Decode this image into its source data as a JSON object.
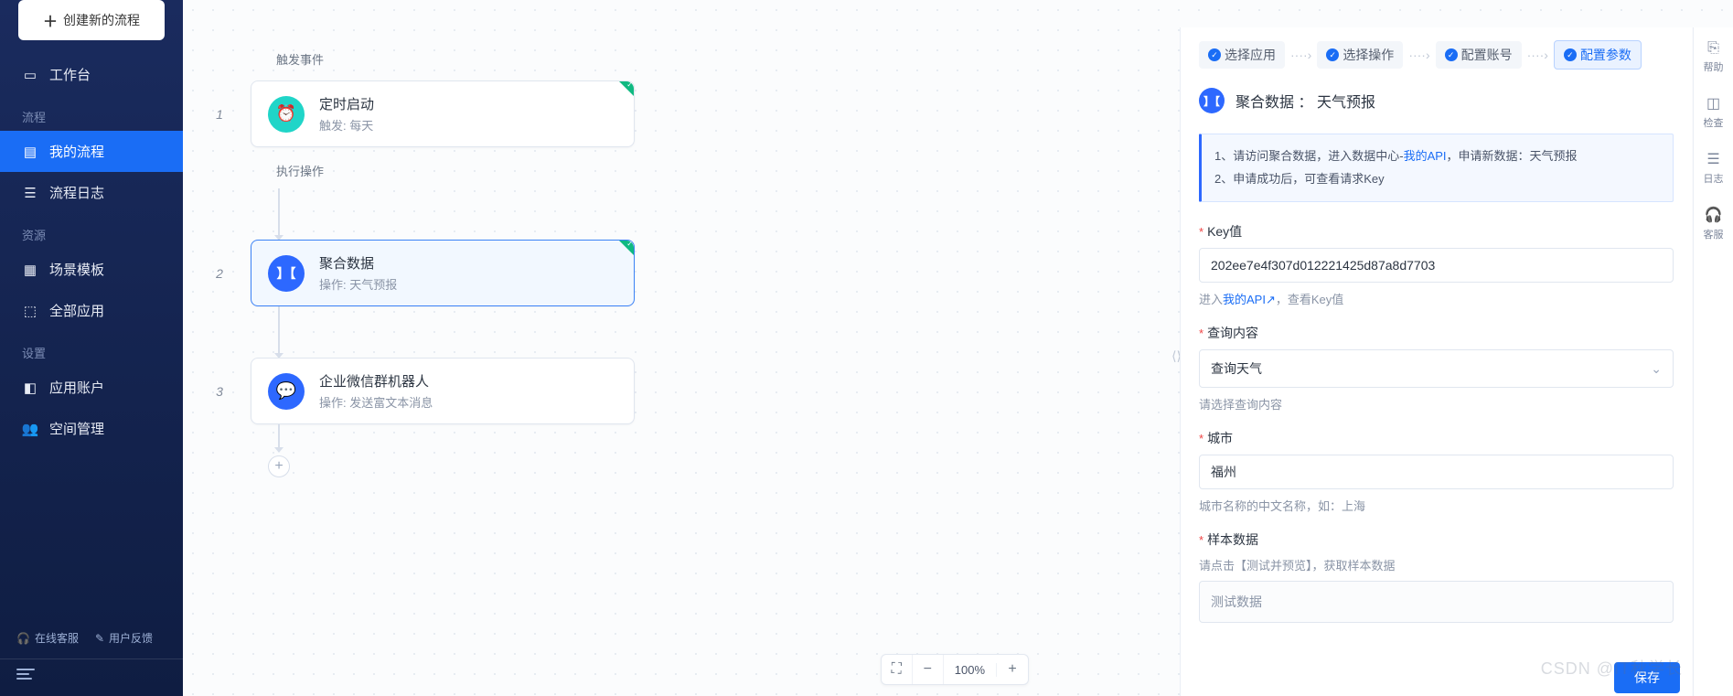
{
  "sidebar": {
    "create_label": "创建新的流程",
    "workspace": "工作台",
    "sections": {
      "flow": "流程",
      "resource": "资源",
      "settings": "设置"
    },
    "items": {
      "my_flows": "我的流程",
      "flow_logs": "流程日志",
      "scene_templates": "场景模板",
      "all_apps": "全部应用",
      "app_accounts": "应用账户",
      "space_mgmt": "空间管理"
    },
    "footer": {
      "online_support": "在线客服",
      "feedback": "用户反馈"
    }
  },
  "flow": {
    "trigger_label": "触发事件",
    "exec_label": "执行操作",
    "steps": [
      {
        "num": "1",
        "title": "定时启动",
        "sub_prefix": "触发:",
        "sub_value": "每天",
        "icon": "timer"
      },
      {
        "num": "2",
        "title": "聚合数据",
        "sub_prefix": "操作:",
        "sub_value": "天气预报",
        "icon": "juhe",
        "selected": true
      },
      {
        "num": "3",
        "title": "企业微信群机器人",
        "sub_prefix": "操作:",
        "sub_value": "发送富文本消息",
        "icon": "wework"
      }
    ]
  },
  "zoom": {
    "value": "100%"
  },
  "panel": {
    "steps": [
      "选择应用",
      "选择操作",
      "配置账号",
      "配置参数"
    ],
    "active_step_index": 3,
    "head": {
      "app": "聚合数据",
      "action": "天气预报",
      "sep": "："
    },
    "info": {
      "line1_a": "1、请访问聚合数据，进入数据中心-",
      "line1_link": "我的API",
      "line1_b": "，申请新数据：天气预报",
      "line2": "2、申请成功后，可查看请求Key"
    },
    "fields": {
      "key": {
        "label": "Key值",
        "value": "202ee7e4f307d012221425d87a8d7703",
        "hint_a": "进入",
        "hint_link": "我的API",
        "hint_b": "，查看Key值",
        "ext_icon": "↗"
      },
      "query": {
        "label": "查询内容",
        "value": "查询天气",
        "hint": "请选择查询内容"
      },
      "city": {
        "label": "城市",
        "value": "福州",
        "hint": "城市名称的中文名称，如：上海"
      },
      "sample": {
        "label": "样本数据",
        "hint": "请点击【测试并预览】，获取样本数据",
        "value": "测试数据"
      }
    },
    "save": "保存"
  },
  "dock": {
    "help": "帮助",
    "check": "检查",
    "logs": "日志",
    "svc": "客服"
  },
  "watermark": "CSDN @IT秋学长"
}
